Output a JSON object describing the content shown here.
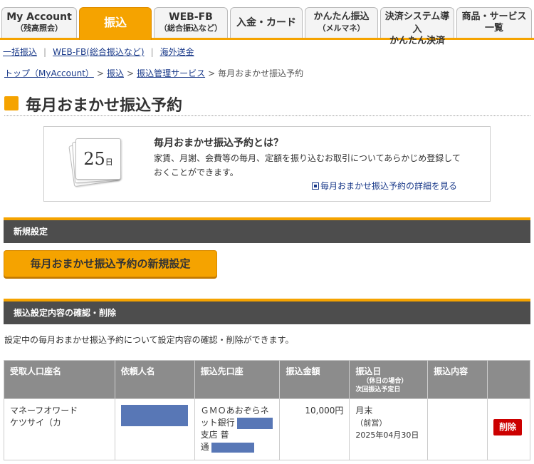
{
  "tabs": [
    {
      "line1": "My Account",
      "line2": "（残高照会）"
    },
    {
      "line1": "振込",
      "line2": ""
    },
    {
      "line1": "WEB-FB",
      "line2": "（総合振込など）"
    },
    {
      "line1": "入金・カード",
      "line2": ""
    },
    {
      "line1": "かんたん振込",
      "line2": "（メルマネ）"
    },
    {
      "line1": "決済システム導入",
      "line2": "かんたん決済"
    },
    {
      "line1": "商品・サービス",
      "line2": "一覧"
    }
  ],
  "subnav": [
    "一括振込",
    "WEB-FB(総合振込など)",
    "海外送金"
  ],
  "breadcrumb": [
    "トップ（MyAccount）",
    "振込",
    "振込管理サービス",
    "毎月おまかせ振込予約"
  ],
  "page_title": "毎月おまかせ振込予約",
  "info": {
    "calendar_number": "25",
    "calendar_unit": "日",
    "heading": "毎月おまかせ振込予約とは？",
    "body": "家賃、月謝、会費等の毎月、定額を振り込むお取引についてあらかじめ登録しておくことができます。",
    "link": "毎月おまかせ振込予約の詳細を見る"
  },
  "section_new": "新規設定",
  "new_button": "毎月おまかせ振込予約の新規設定",
  "section_confirm": "振込設定内容の確認・削除",
  "confirm_desc": "設定中の毎月おまかせ振込予約について設定内容の確認・削除ができます。",
  "table": {
    "headers": {
      "payee": "受取人口座名",
      "requester": "依頼人名",
      "dest": "振込先口座",
      "amount": "振込金額",
      "date": "振込日",
      "date_sub1": "（休日の場合）",
      "date_sub2": "次回振込予定日",
      "content": "振込内容"
    },
    "rows": [
      {
        "payee_l1": "マネーフオワード",
        "payee_l2": "ケツサイ（カ",
        "bank_l1": "ＧＭＯあおぞらネ",
        "bank_l2": "ット銀行",
        "bank_l3": "支店 普",
        "bank_l4": "通",
        "amount": "10,000円",
        "day": "月末",
        "holiday": "（前営）",
        "next_date": "2025年04月30日",
        "delete": "削除"
      }
    ]
  },
  "colors": {
    "accent": "#f5a300",
    "section_bg": "#4d4d4d",
    "table_head": "#8c8c8c",
    "mask": "#5877b6",
    "delete": "#cc0000"
  }
}
